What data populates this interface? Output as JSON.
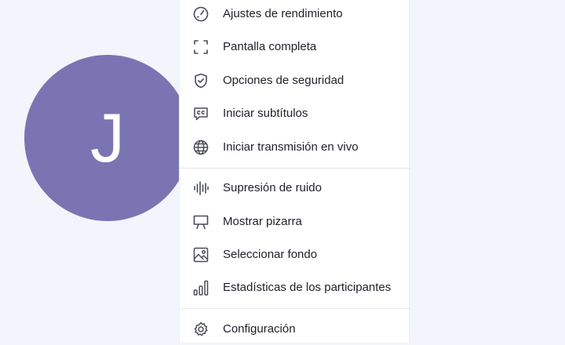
{
  "avatar": {
    "initial": "J",
    "color": "#7b74b3"
  },
  "menu": {
    "items": [
      {
        "label": "Ajustes de rendimiento",
        "icon": "speedometer-icon"
      },
      {
        "label": "Pantalla completa",
        "icon": "fullscreen-icon"
      },
      {
        "label": "Opciones de seguridad",
        "icon": "shield-check-icon"
      },
      {
        "label": "Iniciar subtítulos",
        "icon": "closed-captions-icon"
      },
      {
        "label": "Iniciar transmisión en vivo",
        "icon": "globe-icon"
      },
      {
        "label": "Supresión de ruido",
        "icon": "sound-wave-icon"
      },
      {
        "label": "Mostrar pizarra",
        "icon": "whiteboard-icon"
      },
      {
        "label": "Seleccionar fondo",
        "icon": "image-icon"
      },
      {
        "label": "Estadísticas de los participantes",
        "icon": "bar-chart-icon"
      },
      {
        "label": "Configuración",
        "icon": "gear-icon"
      }
    ]
  }
}
